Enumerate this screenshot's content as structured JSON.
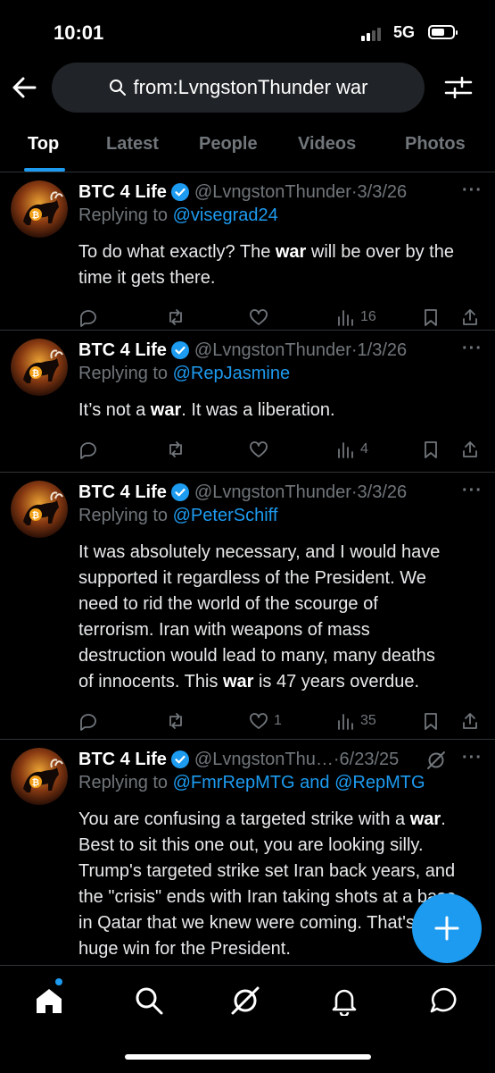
{
  "status_bar": {
    "time": "10:01",
    "network": "5G"
  },
  "search": {
    "query": "from:LvngstonThunder war"
  },
  "tabs": [
    {
      "label": "Top"
    },
    {
      "label": "Latest"
    },
    {
      "label": "People"
    },
    {
      "label": "Videos"
    },
    {
      "label": "Photos"
    }
  ],
  "posts": [
    {
      "name": "BTC 4 Life",
      "handle": "@LvngstonThunder",
      "date": "3/3/26",
      "replying_prefix": "Replying to",
      "replying_to": "@visegrad24",
      "lines": [
        [
          "To do what exactly?  The ",
          "war",
          " will be over by the"
        ],
        [
          "time it gets there.",
          "",
          ""
        ]
      ],
      "likes": "",
      "views": "16"
    },
    {
      "name": "BTC 4 Life",
      "handle": "@LvngstonThunder",
      "date": "1/3/26",
      "replying_prefix": "Replying to",
      "replying_to": "@RepJasmine",
      "lines": [
        [
          "It’s not a ",
          "war",
          ".  It was a liberation."
        ]
      ],
      "likes": "",
      "views": "4"
    },
    {
      "name": "BTC 4 Life",
      "handle": "@LvngstonThunder",
      "date": "3/3/26",
      "replying_prefix": "Replying to",
      "replying_to": "@PeterSchiff",
      "lines": [
        [
          "It was absolutely necessary, and I would have",
          "",
          ""
        ],
        [
          "supported it regardless of the President.  We",
          "",
          ""
        ],
        [
          "need to rid the world of the scourge of",
          "",
          ""
        ],
        [
          "terrorism.  Iran with weapons of mass",
          "",
          ""
        ],
        [
          "destruction would lead to many, many deaths",
          "",
          ""
        ],
        [
          "of innocents.  This ",
          "war",
          " is 47 years overdue."
        ]
      ],
      "likes": "1",
      "views": "35"
    },
    {
      "name": "BTC 4 Life",
      "handle": "@LvngstonThu…",
      "date": "6/23/25",
      "replying_prefix": "Replying to",
      "replying_to": "@FmrRepMTG and @RepMTG",
      "lines": [
        [
          "You are confusing a targeted strike with a ",
          "war",
          "."
        ],
        [
          "Best to sit this one out, you are looking silly.",
          "",
          ""
        ],
        [
          "Trump's targeted strike set Iran back years, and",
          "",
          ""
        ],
        [
          "the \"crisis\" ends with Iran taking shots at a base",
          "",
          ""
        ],
        [
          "in Qatar that we knew were coming.  That's a",
          "",
          ""
        ],
        [
          "huge win for the President.",
          "",
          ""
        ]
      ],
      "likes": "",
      "views": ""
    }
  ],
  "colors": {
    "accent": "#1d9bf0",
    "muted": "#71767b",
    "text": "#e7e9ea",
    "background": "#000000"
  },
  "icons": {
    "nav": [
      "home-icon",
      "search-icon",
      "grok-icon",
      "notifications-icon",
      "messages-icon"
    ],
    "actions": [
      "reply-icon",
      "repost-icon",
      "like-icon",
      "views-icon",
      "bookmark-icon",
      "share-icon"
    ]
  }
}
